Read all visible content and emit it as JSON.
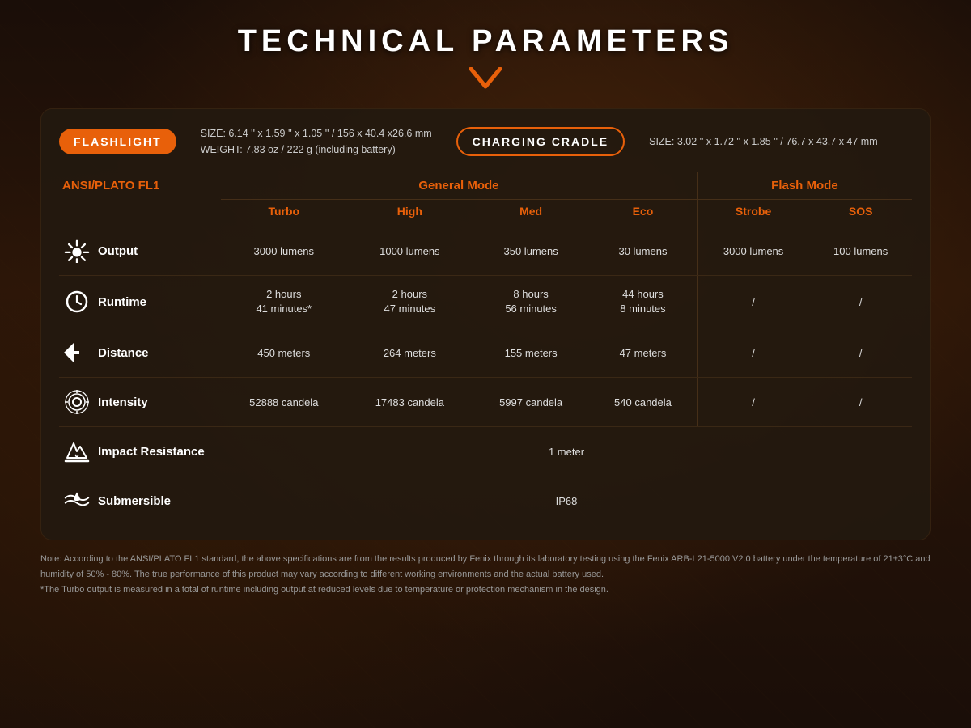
{
  "page": {
    "title": "TECHNICAL PARAMETERS"
  },
  "flashlight": {
    "badge": "FLASHLIGHT",
    "size": "SIZE: 6.14 '' x 1.59 '' x 1.05 '' / 156 x 40.4 x26.6 mm",
    "weight": "WEIGHT: 7.83 oz / 222 g (including battery)"
  },
  "chargingCradle": {
    "badge": "CHARGING CRADLE",
    "size": "SIZE: 3.02 '' x 1.72 '' x 1.85 '' / 76.7 x 43.7 x 47 mm"
  },
  "table": {
    "ansi_label": "ANSI/PLATO FL1",
    "general_mode": "General Mode",
    "flash_mode": "Flash Mode",
    "columns": {
      "turbo": "Turbo",
      "high": "High",
      "med": "Med",
      "eco": "Eco",
      "strobe": "Strobe",
      "sos": "SOS"
    },
    "rows": {
      "output": {
        "label": "Output",
        "turbo": "3000 lumens",
        "high": "1000 lumens",
        "med": "350 lumens",
        "eco": "30 lumens",
        "strobe": "3000 lumens",
        "sos": "100 lumens"
      },
      "runtime": {
        "label": "Runtime",
        "turbo": "2 hours\n41 minutes*",
        "high": "2 hours\n47 minutes",
        "med": "8 hours\n56 minutes",
        "eco": "44 hours\n8 minutes",
        "strobe": "/",
        "sos": "/"
      },
      "distance": {
        "label": "Distance",
        "turbo": "450 meters",
        "high": "264 meters",
        "med": "155 meters",
        "eco": "47 meters",
        "strobe": "/",
        "sos": "/"
      },
      "intensity": {
        "label": "Intensity",
        "turbo": "52888 candela",
        "high": "17483 candela",
        "med": "5997 candela",
        "eco": "540 candela",
        "strobe": "/",
        "sos": "/"
      },
      "impact": {
        "label": "Impact Resistance",
        "value": "1 meter"
      },
      "submersible": {
        "label": "Submersible",
        "value": "IP68"
      }
    }
  },
  "footer": {
    "note1": "Note: According to the ANSI/PLATO FL1 standard, the above specifications are from the results produced by Fenix through its laboratory testing using the Fenix ARB-L21-5000 V2.0 battery under the temperature of 21±3°C and humidity of 50% - 80%. The true performance of this product may vary according to different working environments and the actual battery used.",
    "note2": "*The Turbo output is measured in a total of runtime including output at reduced levels due to temperature or protection mechanism in the design."
  }
}
